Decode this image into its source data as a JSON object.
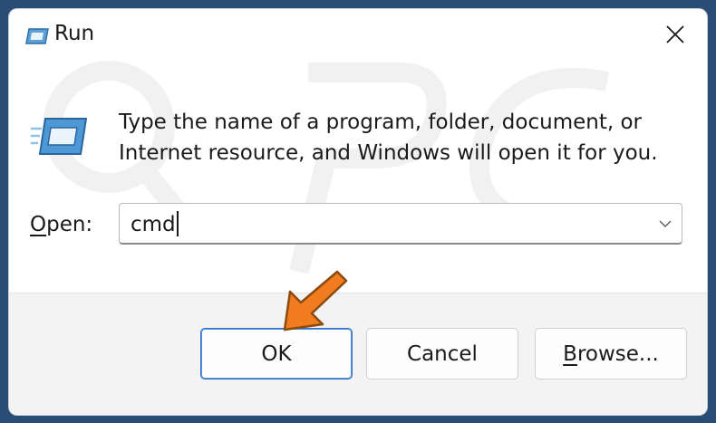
{
  "window": {
    "title": "Run",
    "close_icon": "close-icon"
  },
  "main": {
    "icon": "run-icon",
    "description_line1": "Type the name of a program, folder, document, or",
    "description_line2": "Internet resource, and Windows will open it for you.",
    "open_label_accel": "O",
    "open_label_rest": "pen:",
    "open_value": "cmd",
    "dropdown_icon": "chevron-down-icon"
  },
  "buttons": {
    "ok": "OK",
    "cancel": "Cancel",
    "browse_accel": "B",
    "browse_rest": "rowse..."
  },
  "annotation": {
    "arrow_icon": "pointer-arrow-icon",
    "arrow_color": "#f07c1f"
  },
  "colors": {
    "accent": "#2f70c9",
    "background": "#2a4d78"
  }
}
